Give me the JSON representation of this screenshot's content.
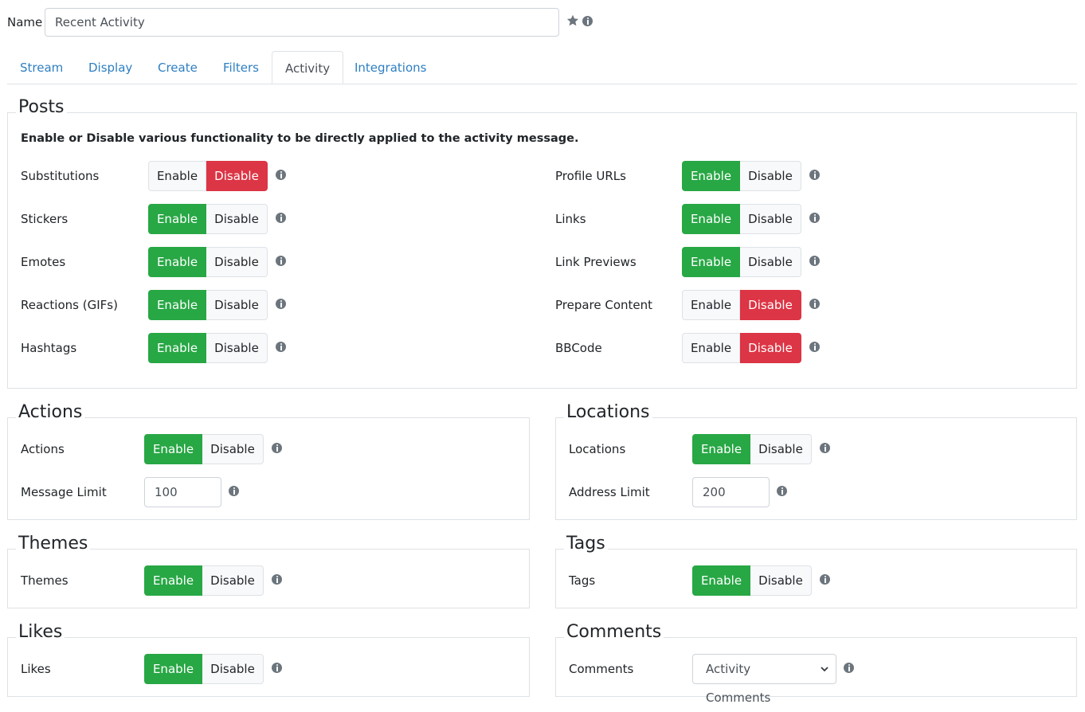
{
  "name": {
    "label": "Name",
    "value": "Recent Activity"
  },
  "tabs": [
    {
      "label": "Stream"
    },
    {
      "label": "Display"
    },
    {
      "label": "Create"
    },
    {
      "label": "Filters"
    },
    {
      "label": "Activity",
      "active": true
    },
    {
      "label": "Integrations"
    }
  ],
  "toggle_labels": {
    "enable": "Enable",
    "disable": "Disable"
  },
  "posts": {
    "legend": "Posts",
    "description": "Enable or Disable various functionality to be directly applied to the activity message.",
    "left": [
      {
        "label": "Substitutions",
        "state": "Disable"
      },
      {
        "label": "Stickers",
        "state": "Enable"
      },
      {
        "label": "Emotes",
        "state": "Enable"
      },
      {
        "label": "Reactions (GIFs)",
        "state": "Enable"
      },
      {
        "label": "Hashtags",
        "state": "Enable"
      }
    ],
    "right": [
      {
        "label": "Profile URLs",
        "state": "Enable"
      },
      {
        "label": "Links",
        "state": "Enable"
      },
      {
        "label": "Link Previews",
        "state": "Enable"
      },
      {
        "label": "Prepare Content",
        "state": "Disable"
      },
      {
        "label": "BBCode",
        "state": "Disable"
      }
    ]
  },
  "actions": {
    "legend": "Actions",
    "toggle_label": "Actions",
    "state": "Enable",
    "limit_label": "Message Limit",
    "limit_value": "100"
  },
  "locations": {
    "legend": "Locations",
    "toggle_label": "Locations",
    "state": "Enable",
    "limit_label": "Address Limit",
    "limit_value": "200"
  },
  "themes": {
    "legend": "Themes",
    "toggle_label": "Themes",
    "state": "Enable"
  },
  "tags": {
    "legend": "Tags",
    "toggle_label": "Tags",
    "state": "Enable"
  },
  "likes": {
    "legend": "Likes",
    "toggle_label": "Likes",
    "state": "Enable"
  },
  "comments": {
    "legend": "Comments",
    "label": "Comments",
    "selected": "Activity Comments"
  },
  "colors": {
    "enable_active": "#28a745",
    "disable_active": "#dc3545",
    "link": "#2e7fc2"
  },
  "icons": {
    "favorite": "star-icon",
    "help": "info-icon",
    "select": "chevron-down-icon"
  }
}
